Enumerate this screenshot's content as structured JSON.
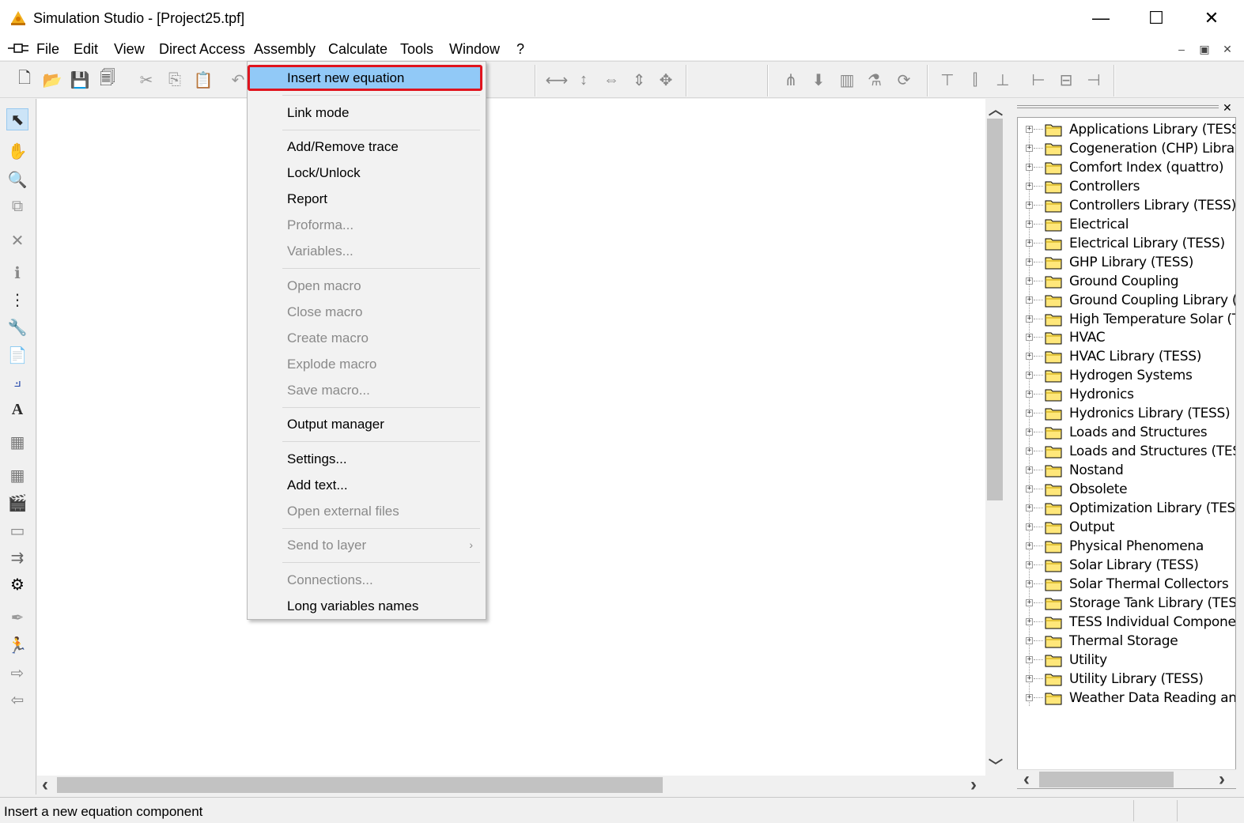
{
  "window": {
    "title": "Simulation Studio - [Project25.tpf]",
    "minimize_glyph": "—",
    "maximize_glyph": "☐",
    "close_glyph": "✕"
  },
  "menubar": {
    "items": [
      "File",
      "Edit",
      "View",
      "Direct Access",
      "Assembly",
      "Calculate",
      "Tools",
      "Window",
      "?"
    ],
    "mdi_minimize": "–",
    "mdi_restore": "▣",
    "mdi_close": "✕"
  },
  "assembly_menu": {
    "items": [
      {
        "label": "Insert new equation",
        "enabled": true,
        "highlighted": true
      },
      {
        "label": "Link mode",
        "enabled": true
      },
      {
        "label": "Add/Remove trace",
        "enabled": true
      },
      {
        "label": "Lock/Unlock",
        "enabled": true
      },
      {
        "label": "Report",
        "enabled": true
      },
      {
        "label": "Proforma...",
        "enabled": false
      },
      {
        "label": "Variables...",
        "enabled": false
      },
      {
        "label": "Open macro",
        "enabled": false
      },
      {
        "label": "Close macro",
        "enabled": false
      },
      {
        "label": "Create macro",
        "enabled": false
      },
      {
        "label": "Explode macro",
        "enabled": false
      },
      {
        "label": "Save macro...",
        "enabled": false
      },
      {
        "label": "Output manager",
        "enabled": true
      },
      {
        "label": "Settings...",
        "enabled": true
      },
      {
        "label": "Add text...",
        "enabled": true
      },
      {
        "label": "Open external files",
        "enabled": false
      },
      {
        "label": "Send to layer",
        "enabled": false,
        "submenu": true
      },
      {
        "label": "Connections...",
        "enabled": false
      },
      {
        "label": "Long variables names",
        "enabled": true
      }
    ],
    "submenu_glyph": "›"
  },
  "right_panel": {
    "close_glyph": "✕",
    "expander_glyph": "+",
    "tree_items": [
      "Applications Library (TESS)",
      "Cogeneration (CHP) Library (T",
      "Comfort Index (quattro)",
      "Controllers",
      "Controllers Library (TESS)",
      "Electrical",
      "Electrical Library (TESS)",
      "GHP Library (TESS)",
      "Ground Coupling",
      "Ground Coupling Library (TES",
      "High Temperature Solar (TES",
      "HVAC",
      "HVAC Library (TESS)",
      "Hydrogen Systems",
      "Hydronics",
      "Hydronics Library (TESS)",
      "Loads and Structures",
      "Loads and Structures (TESS)",
      "Nostand",
      "Obsolete",
      "Optimization Library (TESS)",
      "Output",
      "Physical Phenomena",
      "Solar Library (TESS)",
      "Solar Thermal Collectors",
      "Storage Tank Library (TESS)",
      "TESS Individual Components",
      "Thermal Storage",
      "Utility",
      "Utility Library (TESS)",
      "Weather Data Reading and P"
    ]
  },
  "scrollbars": {
    "up": "︿",
    "down": "﹀",
    "left": "‹",
    "right": "›"
  },
  "statusbar": {
    "text": "Insert a new equation component"
  },
  "toolbar": {
    "icons": [
      "new-file-icon",
      "open-folder-icon",
      "save-icon",
      "save-all-icon",
      "cut-icon",
      "copy-icon",
      "paste-icon",
      "undo-icon",
      "align-h-distance-icon",
      "align-v-distance-icon",
      "same-width-icon",
      "same-height-icon",
      "same-size-icon",
      "hierarchy-icon",
      "arrow-down-icon",
      "table-icon",
      "flask-icon",
      "for-loop-icon",
      "align-top-icon",
      "align-middle-icon",
      "align-bottom-icon",
      "align-left-icon",
      "align-center-icon",
      "align-right-icon"
    ],
    "glyphs": {
      "new": "🗋",
      "open": "📂",
      "save": "💾",
      "saveall": "🗐",
      "cut": "✂",
      "copy": "⎘",
      "paste": "📋",
      "undo": "↶",
      "hdist": "⟷",
      "vdist": "↕",
      "samew": "⇔",
      "sameh": "⇕",
      "samesize": "✥",
      "hier": "⋔",
      "down": "⬇",
      "table": "▥",
      "flask": "⚗",
      "for": "⟳",
      "atop": "⊤",
      "amid": "⫿",
      "abot": "⊥",
      "aleft": "⊢",
      "acen": "⊟",
      "aright": "⊣"
    }
  },
  "left_toolbar": {
    "glyphs": [
      "⬉",
      "✋",
      "🔍",
      "⧉",
      "✕",
      "ℹ",
      "⋮",
      "🔧",
      "📄",
      "⟓",
      "A",
      "▦",
      "▦",
      "🎬",
      "▭",
      "⇉",
      "⚙",
      "✒",
      "🏃",
      "⇨",
      "⇦"
    ]
  }
}
